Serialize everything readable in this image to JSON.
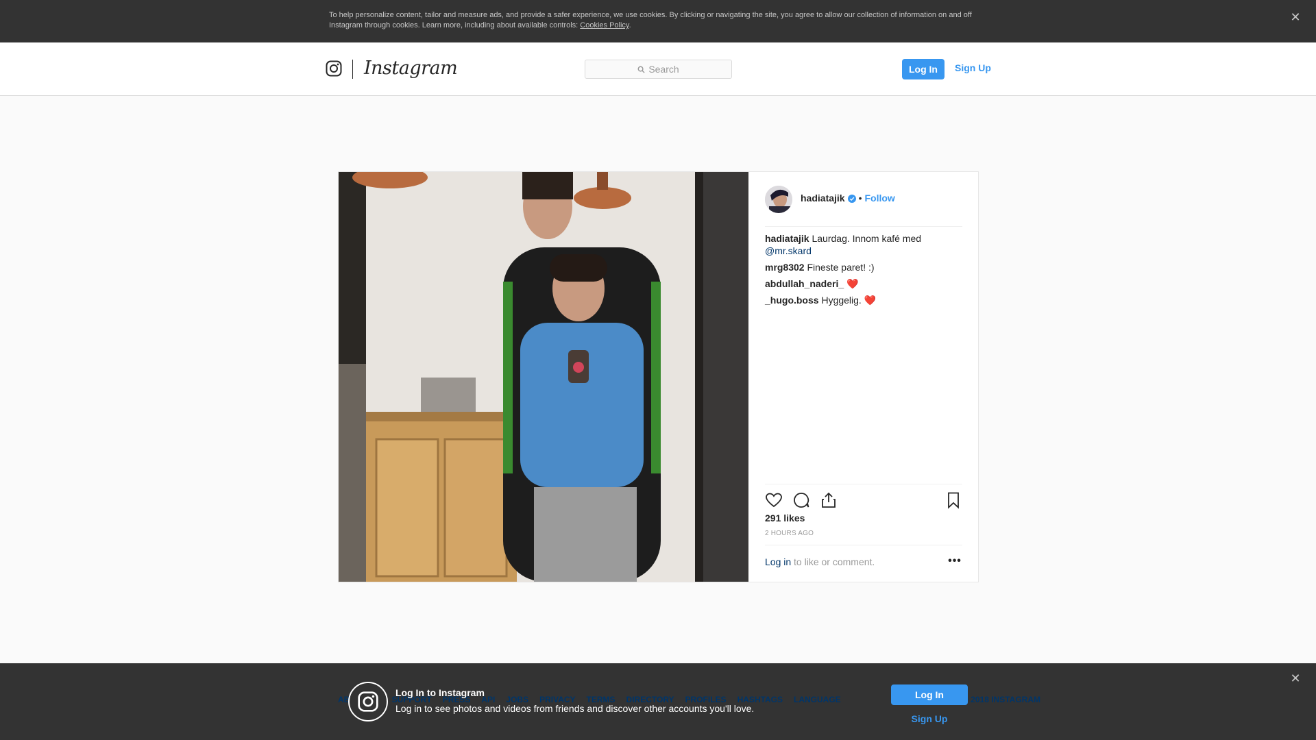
{
  "cookie_banner": {
    "text": "To help personalize content, tailor and measure ads, and provide a safer experience, we use cookies. By clicking or navigating the site, you agree to allow our collection of information on and off Instagram through cookies. Learn more, including about available controls: ",
    "policy_link": "Cookies Policy",
    "period": ".",
    "close_glyph": "✕"
  },
  "header": {
    "logo_text": "Instagram",
    "search_placeholder": "Search",
    "login_label": "Log In",
    "signup_label": "Sign Up"
  },
  "post": {
    "author": "hadiatajik",
    "dot": "•",
    "follow_label": "Follow",
    "comments": [
      {
        "user": "hadiatajik",
        "text": "Laurdag. Innom kafé med",
        "mention": "@mr.skard"
      },
      {
        "user": "mrg8302",
        "text": "Fineste paret! :)"
      },
      {
        "user": "abdullah_naderi_",
        "text": "❤️"
      },
      {
        "user": "_hugo.boss",
        "text": "Hyggelig. ❤️"
      }
    ],
    "likes": "291 likes",
    "time": "2 HOURS AGO",
    "login_link": "Log in",
    "login_suffix": " to like or comment.",
    "more_glyph": "•••"
  },
  "footer": {
    "links": [
      "ABOUT US",
      "SUPPORT",
      "PRESS",
      "API",
      "JOBS",
      "PRIVACY",
      "TERMS",
      "DIRECTORY",
      "PROFILES",
      "HASHTAGS",
      "LANGUAGE"
    ],
    "right_text": "© 2018 INSTAGRAM"
  },
  "login_prompt": {
    "title": "Log In to Instagram",
    "subtitle": "Log in to see photos and videos from friends and discover other accounts you'll love.",
    "login_label": "Log In",
    "signup_label": "Sign Up",
    "close_glyph": "✕"
  },
  "colors": {
    "accent": "#3897f0",
    "link_dark": "#003569",
    "banner_bg": "#333333"
  }
}
